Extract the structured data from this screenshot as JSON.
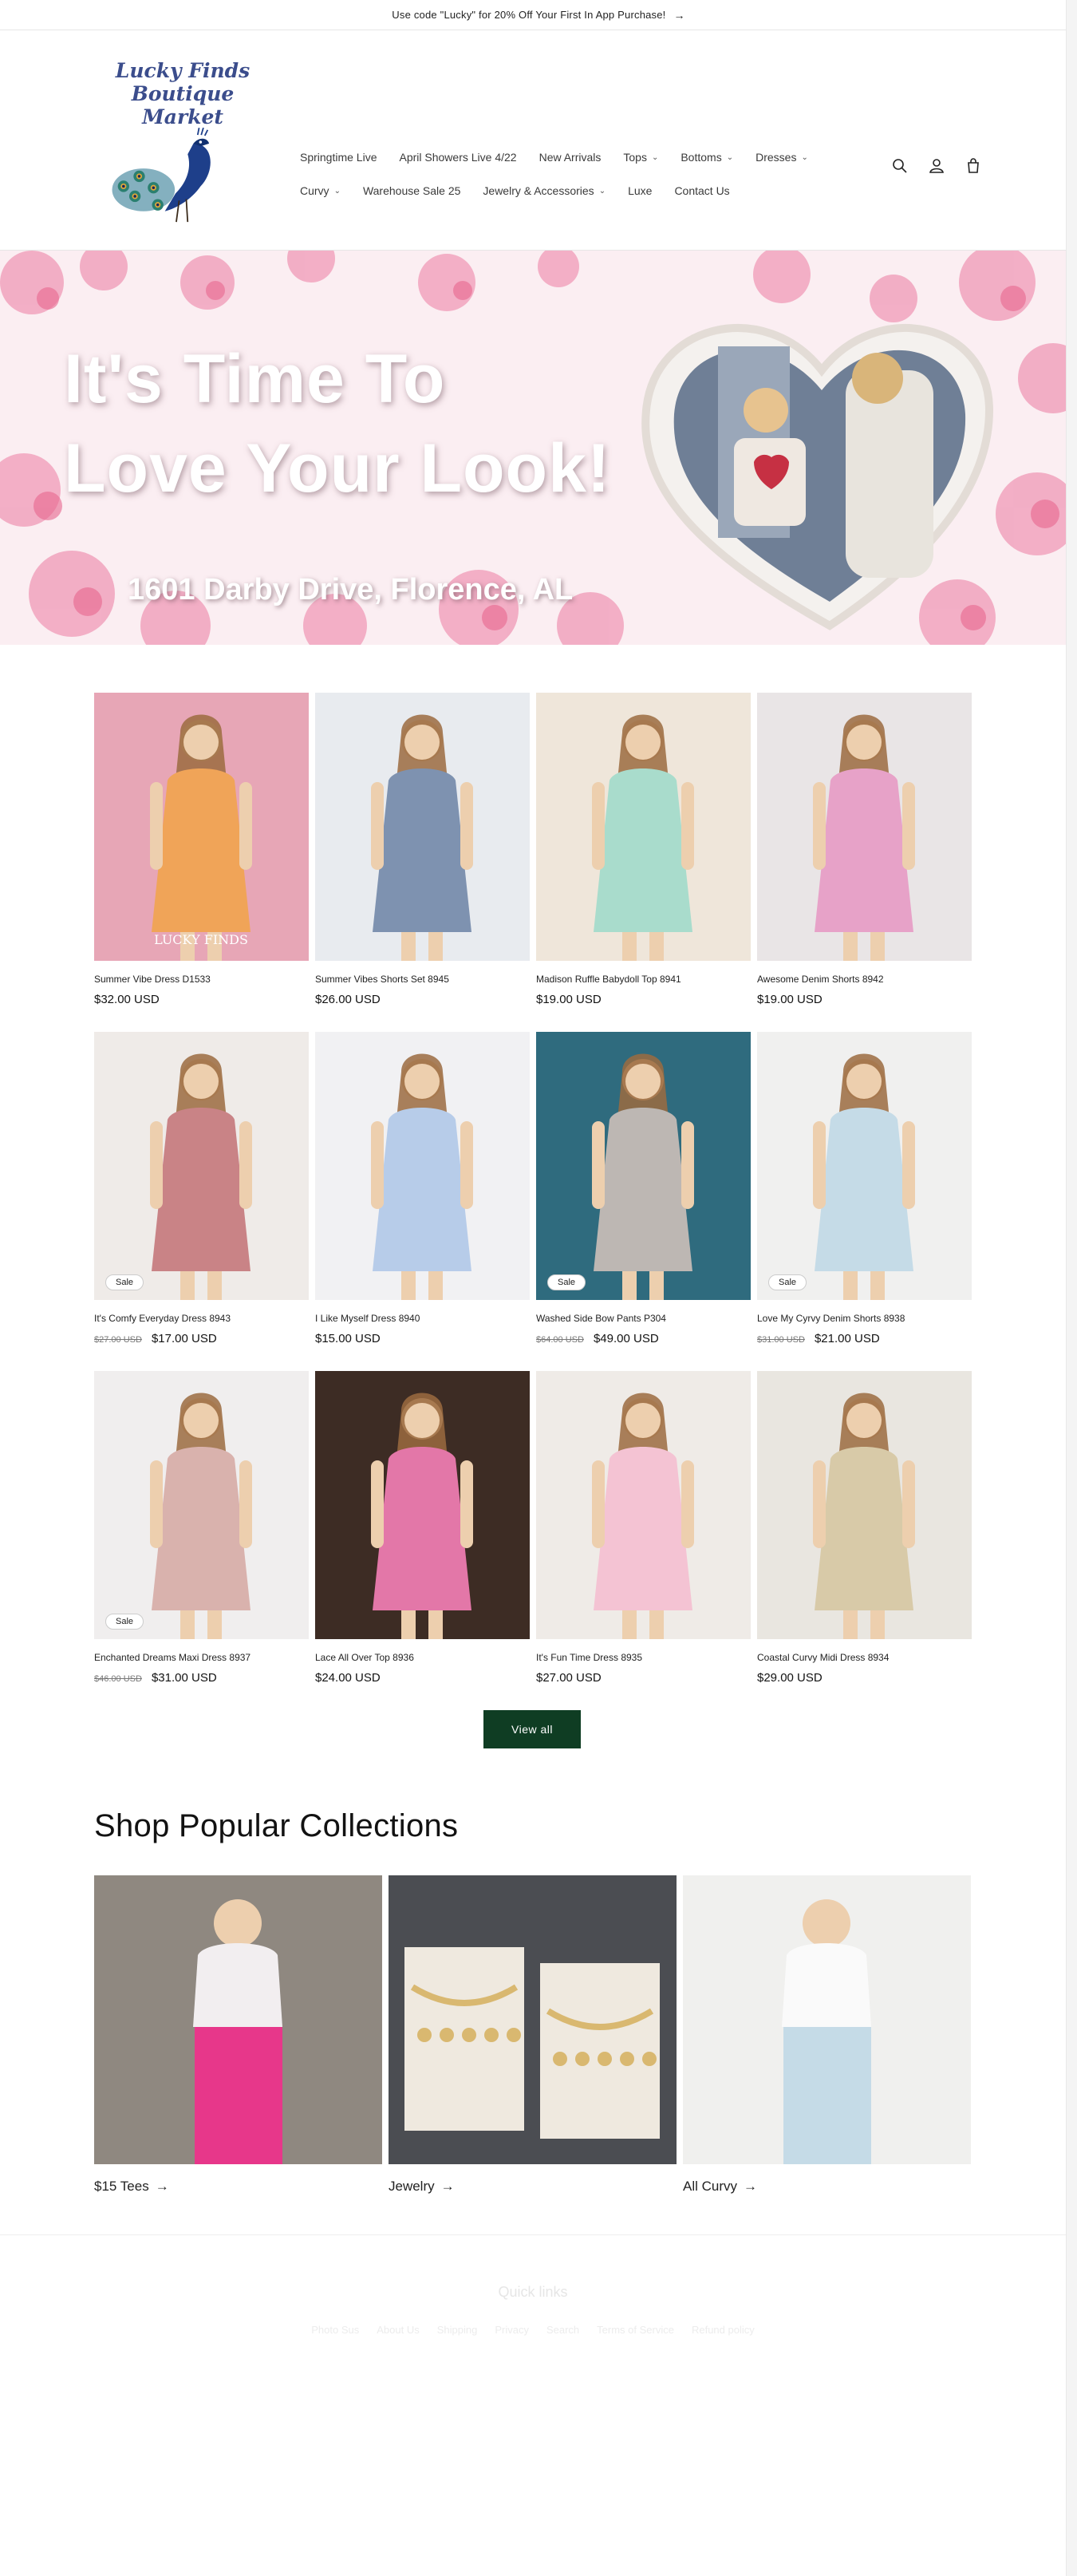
{
  "announcement": {
    "text": "Use code \"Lucky\" for 20% Off Your First In App Purchase!"
  },
  "brand": {
    "logo_line1": "Lucky Finds",
    "logo_line2": "Boutique Market"
  },
  "nav": {
    "row1": [
      {
        "label": "Springtime Live",
        "dropdown": false
      },
      {
        "label": "April Showers Live 4/22",
        "dropdown": false
      },
      {
        "label": "New Arrivals",
        "dropdown": false
      },
      {
        "label": "Tops",
        "dropdown": true
      },
      {
        "label": "Bottoms",
        "dropdown": true
      },
      {
        "label": "Dresses",
        "dropdown": true
      }
    ],
    "row2": [
      {
        "label": "Curvy",
        "dropdown": true
      },
      {
        "label": "Warehouse Sale 25",
        "dropdown": false
      },
      {
        "label": "Jewelry & Accessories",
        "dropdown": true
      },
      {
        "label": "Luxe",
        "dropdown": false
      },
      {
        "label": "Contact Us",
        "dropdown": false
      }
    ]
  },
  "hero": {
    "line1": "It's Time To",
    "line2": "Love Your Look!",
    "address": "1601 Darby Drive, Florence, AL",
    "shirt_text": "LOVE"
  },
  "products": [
    {
      "name": "Summer Vibe Dress D1533",
      "price": "$32.00 USD",
      "old_price": "",
      "sale": false,
      "bg": "#e7a6b6",
      "garment": "#f0a458",
      "watermark": "LUCKY FINDS"
    },
    {
      "name": "Summer Vibes Shorts Set 8945",
      "price": "$26.00 USD",
      "old_price": "",
      "sale": false,
      "bg": "#e8ebef",
      "garment": "#7e92b0"
    },
    {
      "name": "Madison Ruffle Babydoll Top 8941",
      "price": "$19.00 USD",
      "old_price": "",
      "sale": false,
      "bg": "#efe6da",
      "garment": "#a9dccc"
    },
    {
      "name": "Awesome Denim Shorts 8942",
      "price": "$19.00 USD",
      "old_price": "",
      "sale": false,
      "bg": "#e9e5e6",
      "garment": "#e7a2c8"
    },
    {
      "name": "It's Comfy Everyday Dress 8943",
      "price": "$17.00 USD",
      "old_price": "$27.00 USD",
      "sale": true,
      "bg": "#efebe8",
      "garment": "#c98386"
    },
    {
      "name": "I Like Myself Dress 8940",
      "price": "$15.00 USD",
      "old_price": "",
      "sale": false,
      "bg": "#f1f1f3",
      "garment": "#b7cce9"
    },
    {
      "name": "Washed Side Bow Pants P304",
      "price": "$49.00 USD",
      "old_price": "$64.00 USD",
      "sale": true,
      "bg": "#2f6b7e",
      "garment": "#bdb7b3"
    },
    {
      "name": "Love My Cyrvy Denim Shorts 8938",
      "price": "$21.00 USD",
      "old_price": "$31.00 USD",
      "sale": true,
      "bg": "#f0f0ef",
      "garment": "#c5dbe7"
    },
    {
      "name": "Enchanted Dreams Maxi Dress 8937",
      "price": "$31.00 USD",
      "old_price": "$46.00 USD",
      "sale": true,
      "bg": "#f0eeee",
      "garment": "#d9b2ad"
    },
    {
      "name": "Lace All Over Top 8936",
      "price": "$24.00 USD",
      "old_price": "",
      "sale": false,
      "bg": "#3d2c24",
      "garment": "#e377a8"
    },
    {
      "name": "It's Fun Time Dress 8935",
      "price": "$27.00 USD",
      "old_price": "",
      "sale": false,
      "bg": "#efebe7",
      "garment": "#f4c3d3"
    },
    {
      "name": "Coastal Curvy Midi Dress 8934",
      "price": "$29.00 USD",
      "old_price": "",
      "sale": false,
      "bg": "#e9e6e0",
      "garment": "#d8caa8"
    }
  ],
  "sale_badge": "Sale",
  "view_all": "View all",
  "popular": {
    "title": "Shop Popular Collections",
    "items": [
      {
        "label": "$15 Tees",
        "bg": "#8f8880",
        "garment": "#e7378a"
      },
      {
        "label": "Jewelry",
        "bg": "#4b4d52",
        "garment": "#d9b870"
      },
      {
        "label": "All Curvy",
        "bg": "#f0f0ee",
        "garment": "#c5dbe7"
      }
    ]
  },
  "footer": {
    "quick_title": "Quick links",
    "links": [
      "Photo Sus",
      "About Us",
      "Shipping",
      "Privacy",
      "Search",
      "Terms of Service",
      "Refund policy"
    ]
  }
}
